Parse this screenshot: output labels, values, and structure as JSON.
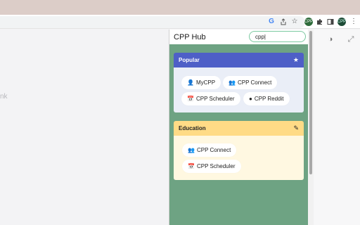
{
  "browser": {
    "toolbar_icons": [
      "google-lens-icon",
      "share-icon",
      "bookmark-star-icon",
      "extension-active-icon",
      "puzzle-icon",
      "sidepanel-icon",
      "profile-avatar-icon",
      "kebab-menu-icon"
    ],
    "google_letter": "G",
    "extension_label": "CPP",
    "profile_label": "CPP"
  },
  "page": {
    "partial_text": "nk"
  },
  "popup": {
    "title": "CPP Hub",
    "search": {
      "value": "cpp|",
      "placeholder": ""
    },
    "cards": [
      {
        "title": "Popular",
        "action_icon": "star-icon",
        "header_color": "#4e5fc7",
        "body_color": "#eaeef7",
        "links": [
          {
            "label": "MyCPP",
            "icon": "user-icon"
          },
          {
            "label": "CPP Connect",
            "icon": "users-icon"
          },
          {
            "label": "CPP Scheduler",
            "icon": "calendar-icon"
          },
          {
            "label": "CPP Reddit",
            "icon": "reddit-icon"
          }
        ]
      },
      {
        "title": "Education",
        "action_icon": "pencil-icon",
        "header_color": "#ffdb86",
        "body_color": "#fff8e1",
        "links": [
          {
            "label": "CPP Connect",
            "icon": "users-icon"
          },
          {
            "label": "CPP Scheduler",
            "icon": "calendar-icon"
          }
        ]
      }
    ]
  }
}
